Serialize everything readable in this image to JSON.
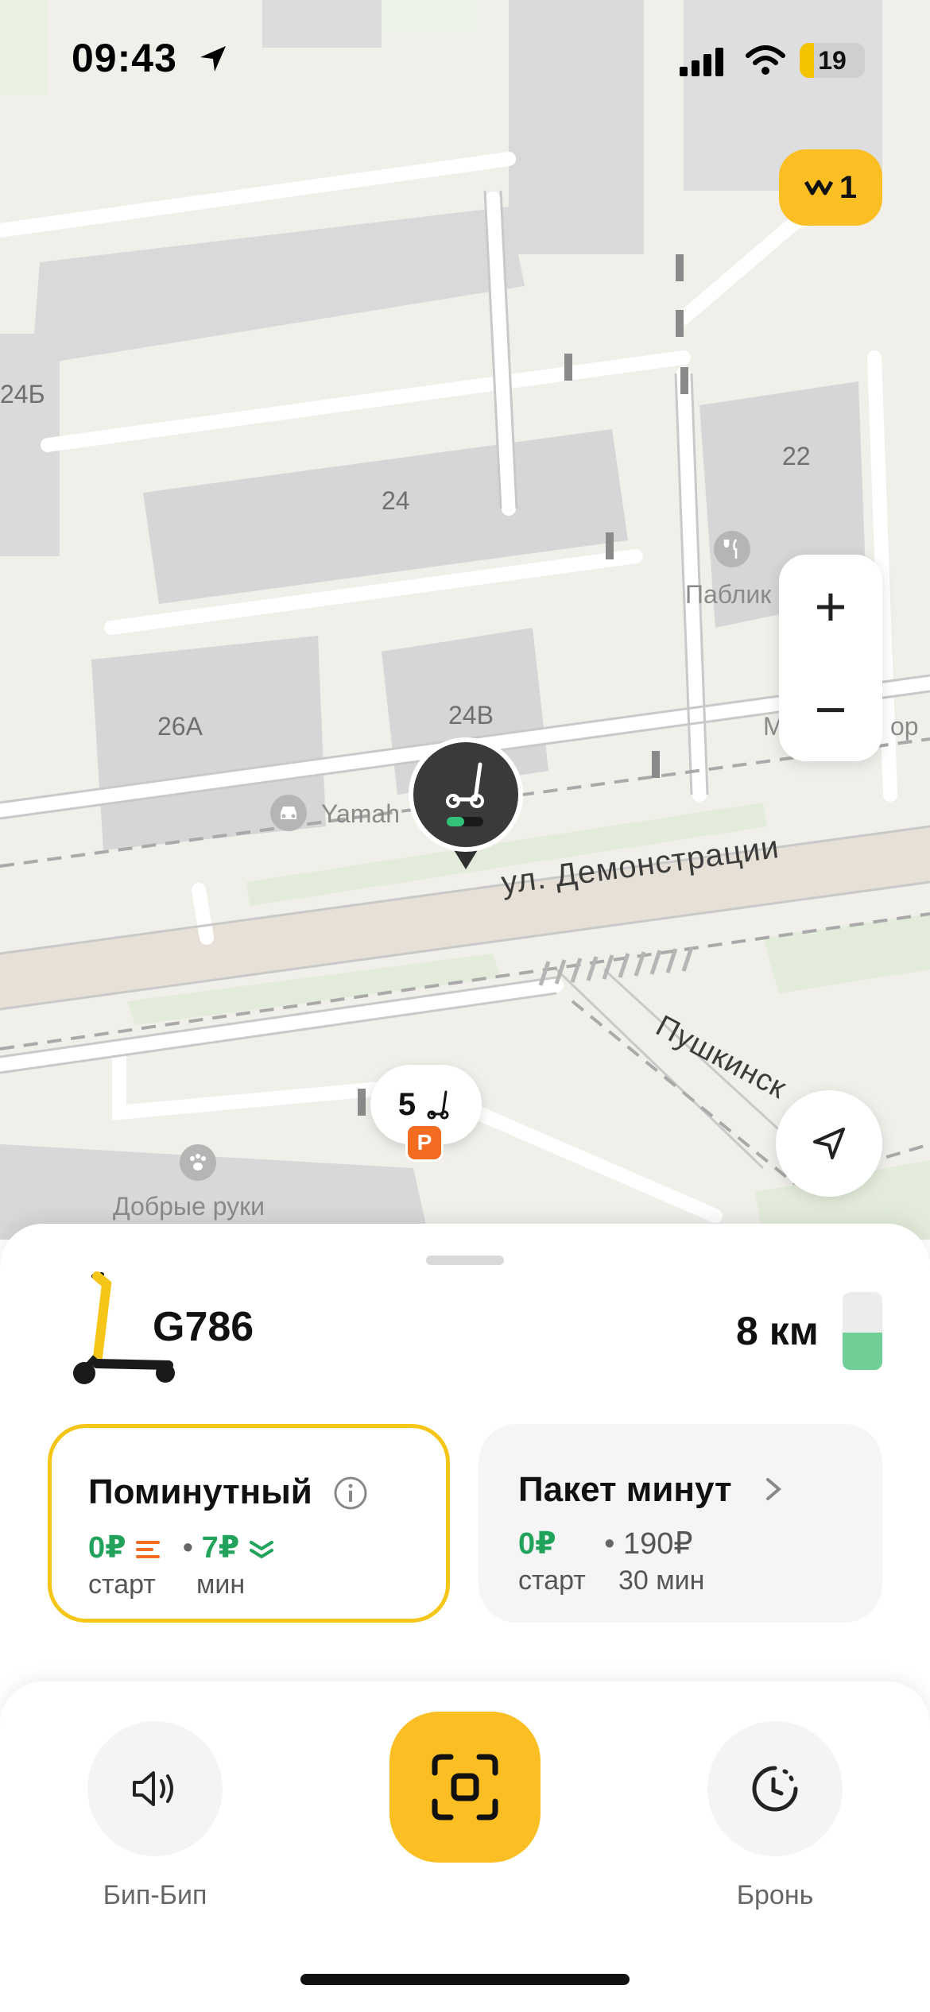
{
  "status_bar": {
    "time": "09:43",
    "battery_level": "19"
  },
  "map": {
    "buildings": [
      "24Б",
      "24",
      "22",
      "26А",
      "24В"
    ],
    "street_main": "ул. Демонстрации",
    "street_side": "Пушкинск",
    "pois": {
      "yamaha": "Yamah",
      "pablik": "Паблик",
      "dobrye_ruki": "Добрые руки",
      "partial_right": "М",
      "partial_right2": "ор"
    },
    "promo_badge": "1",
    "zoom_in": "+",
    "zoom_out": "−",
    "cluster_count": "5",
    "parking_letter": "P"
  },
  "scooter": {
    "id": "G786",
    "range": "8 км",
    "battery_fraction": 0.48
  },
  "tariffs": [
    {
      "title": "Поминутный",
      "start_price": "0₽",
      "minute_price": "7₽",
      "start_label": "старт",
      "minute_label": "мин"
    },
    {
      "title": "Пакет минут",
      "start_price": "0₽",
      "package_price": "190₽",
      "start_label": "старт",
      "package_label": "30 мин"
    }
  ],
  "actions": {
    "beep_label": "Бип-Бип",
    "book_label": "Бронь"
  },
  "colors": {
    "accent": "#fbbf24",
    "green": "#21a35b",
    "parking": "#f36c21",
    "map_bg": "#f0efea"
  }
}
